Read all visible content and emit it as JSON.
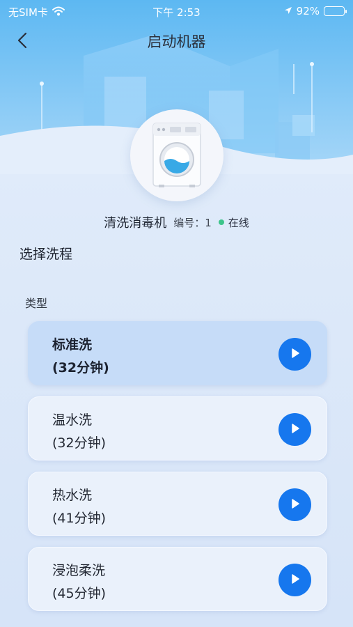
{
  "status_bar": {
    "carrier": "无SIM卡",
    "time": "下午 2:53",
    "battery": "92%",
    "battery_level": 0.92
  },
  "nav": {
    "title": "启动机器",
    "back_icon": "chevron-left-icon"
  },
  "device": {
    "icon": "washing-machine-icon",
    "name": "清洗消毒机",
    "number_label": "编号：1",
    "status": "在线",
    "status_color": "#3cc48a"
  },
  "section_title": "选择洗程",
  "type_label": "类型",
  "programs": [
    {
      "name": "标准洗",
      "duration": "(32分钟)",
      "selected": true
    },
    {
      "name": "温水洗",
      "duration": "(32分钟)",
      "selected": false
    },
    {
      "name": "热水洗",
      "duration": "(41分钟)",
      "selected": false
    },
    {
      "name": "浸泡柔洗",
      "duration": "(45分钟)",
      "selected": false
    }
  ],
  "colors": {
    "accent": "#1677ee",
    "selected_card": "#c6dcf8",
    "card": "#eaf1fb",
    "hero_top": "#6fc0f4"
  }
}
